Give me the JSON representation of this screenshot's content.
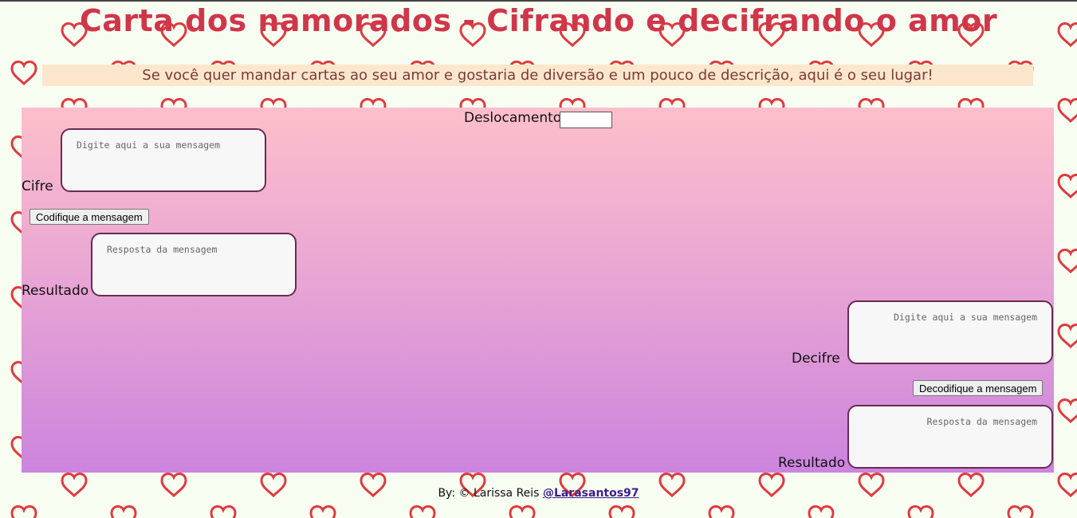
{
  "header": {
    "title": "Carta dos namorados - Cifrando e decifrando o amor",
    "subtitle": "Se você quer mandar cartas ao seu amor e gostaria de diversão e um pouco de descrição, aqui é o seu lugar!"
  },
  "colors": {
    "title": "#d0364a",
    "heart": "#e03a3e",
    "subtitle_bg": "#fde7cc",
    "page_bg": "#f8fdf2",
    "panel_top": "#fdbfcb",
    "panel_bottom": "#cc84de"
  },
  "form": {
    "shift_label": "Deslocamento",
    "shift_value": "",
    "cipher": {
      "label": "Cifre",
      "input_placeholder": "Digite aqui a sua mensagem",
      "button_label": "Codifique a mensagem",
      "result_label": "Resultado",
      "result_placeholder": "Resposta da mensagem"
    },
    "decipher": {
      "label": "Decifre",
      "input_placeholder": "Digite aqui a sua mensagem",
      "button_label": "Decodifique a mensagem",
      "result_label": "Resultado",
      "result_placeholder": "Resposta da mensagem"
    }
  },
  "footer": {
    "prefix": "By: © Larissa Reis",
    "link_text": "@Larasantos97"
  },
  "background": {
    "pattern_icon": "heart-icon"
  }
}
